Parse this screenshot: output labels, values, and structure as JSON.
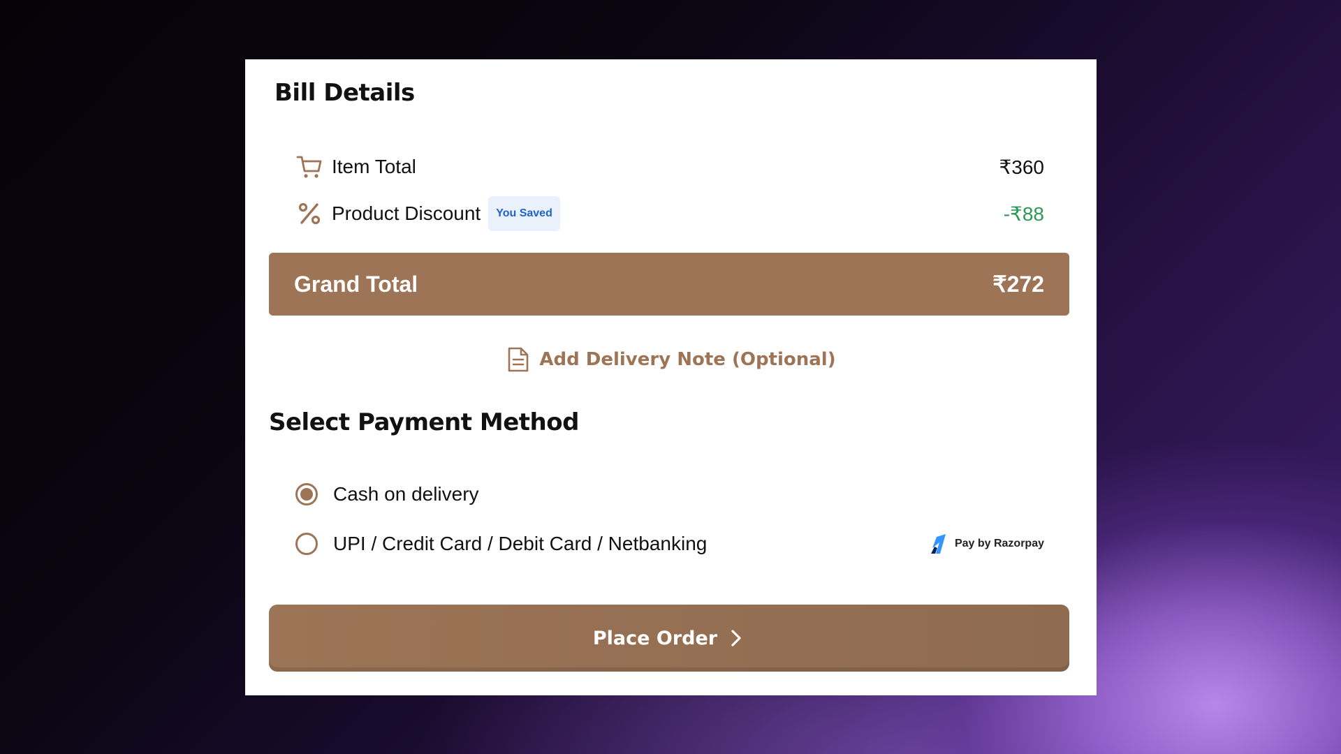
{
  "bill": {
    "title": "Bill Details",
    "item_total": {
      "icon": "cart-icon",
      "label": "Item Total",
      "value": "₹360"
    },
    "product_discount": {
      "icon": "percent-icon",
      "label": "Product Discount",
      "badge": "You Saved",
      "value": "-₹88"
    },
    "grand_total": {
      "label": "Grand Total",
      "value": "₹272"
    }
  },
  "delivery_note": {
    "icon": "document-icon",
    "label": "Add Delivery Note (Optional)"
  },
  "payment": {
    "title": "Select Payment Method",
    "options": [
      {
        "label": "Cash on delivery",
        "selected": true
      },
      {
        "label": "UPI / Credit Card / Debit Card / Netbanking",
        "selected": false,
        "provider": "Pay by Razorpay"
      }
    ]
  },
  "place_order": {
    "label": "Place Order",
    "icon": "chevron-right-icon"
  },
  "colors": {
    "accent": "#9d7456",
    "discount": "#2c9a56",
    "badge_bg": "#eaf1fb",
    "badge_text": "#1e63c8",
    "razorpay_blue": "#3395ff"
  }
}
